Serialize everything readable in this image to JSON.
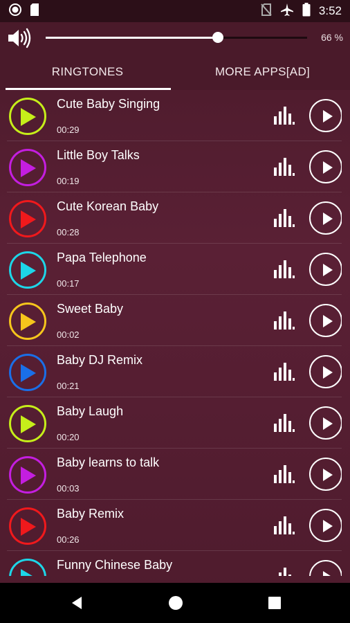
{
  "status_bar": {
    "time": "3:52",
    "left_icons": [
      "record-icon",
      "sd-card-icon"
    ],
    "right_icons": [
      "no-sim-icon",
      "airplane-icon",
      "battery-icon"
    ]
  },
  "volume": {
    "level_percent": 66,
    "label": "66 %"
  },
  "tabs": [
    {
      "label": "RINGTONES",
      "active": true
    },
    {
      "label": "MORE APPS[AD]",
      "active": false
    }
  ],
  "ringtones": [
    {
      "title": "Cute Baby Singing",
      "duration": "00:29",
      "color": "#c6ee1a"
    },
    {
      "title": "Little Boy Talks",
      "duration": "00:19",
      "color": "#c41ee0"
    },
    {
      "title": "Cute Korean Baby",
      "duration": "00:28",
      "color": "#f0191c"
    },
    {
      "title": "Papa Telephone",
      "duration": "00:17",
      "color": "#1dd6e8"
    },
    {
      "title": "Sweet Baby",
      "duration": "00:02",
      "color": "#f6c61c"
    },
    {
      "title": "Baby DJ Remix",
      "duration": "00:21",
      "color": "#1a6fe8"
    },
    {
      "title": "Baby Laugh",
      "duration": "00:20",
      "color": "#c6ee1a"
    },
    {
      "title": "Baby learns to talk",
      "duration": "00:03",
      "color": "#c41ee0"
    },
    {
      "title": "Baby Remix",
      "duration": "00:26",
      "color": "#f0191c"
    },
    {
      "title": "Funny Chinese Baby",
      "duration": "",
      "color": "#1dd6e8"
    }
  ],
  "nav_bar": {
    "buttons": [
      "back-icon",
      "home-icon",
      "recents-icon"
    ]
  }
}
